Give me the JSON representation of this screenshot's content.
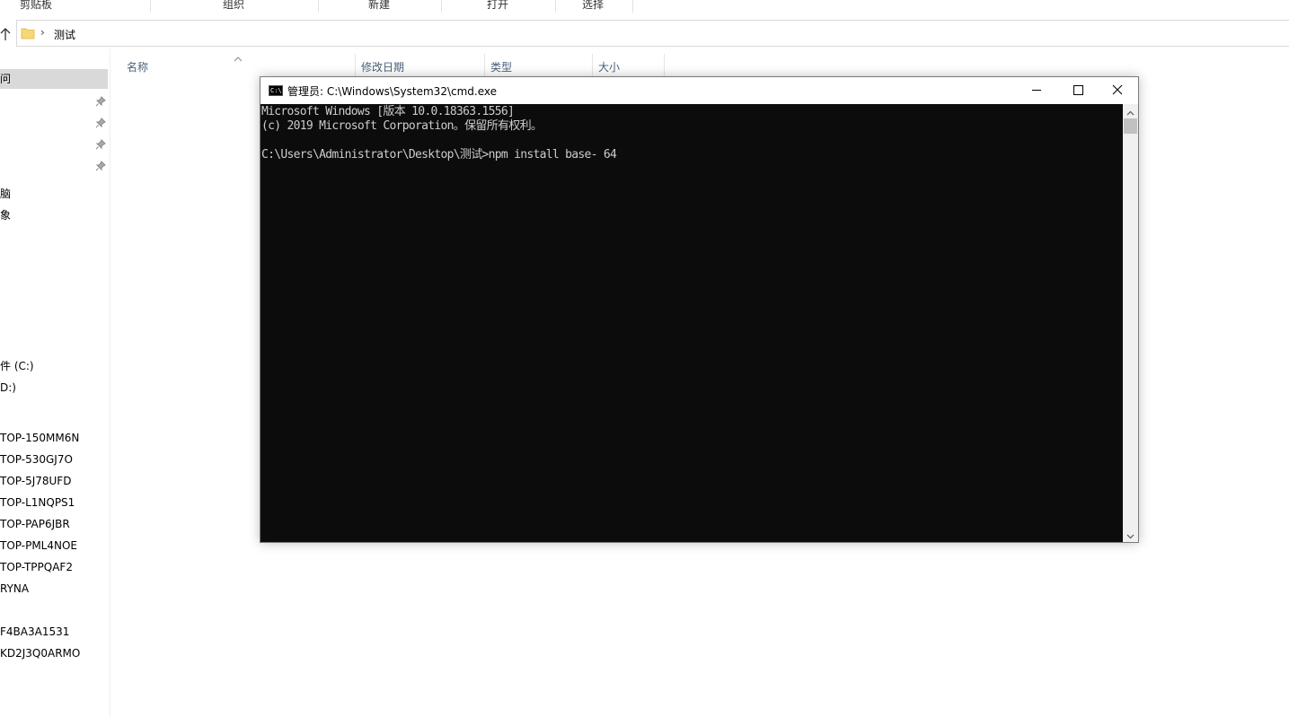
{
  "ribbon": {
    "groups": [
      "剪贴板",
      "组织",
      "新建",
      "打开",
      "选择"
    ]
  },
  "address": {
    "path": "测试"
  },
  "nav": {
    "items_top": [
      "问",
      "脑",
      "象"
    ],
    "drives": [
      "件 (C:)",
      "D:)"
    ],
    "network": [
      "TOP-150MM6N",
      "TOP-530GJ7O",
      "TOP-5J78UFD",
      "TOP-L1NQPS1",
      "TOP-PAP6JBR",
      "TOP-PML4NOE",
      "TOP-TPPQAF2",
      "RYNA",
      "F4BA3A1531",
      "KD2J3Q0ARMO"
    ]
  },
  "columns": {
    "name": "名称",
    "modified": "修改日期",
    "type": "类型",
    "size": "大小"
  },
  "cmd": {
    "title": "管理员: C:\\Windows\\System32\\cmd.exe",
    "icon_text": "C:\\",
    "lines": [
      "Microsoft Windows [版本 10.0.18363.1556]",
      "(c) 2019 Microsoft Corporation。保留所有权利。",
      "",
      "C:\\Users\\Administrator\\Desktop\\测试>npm install base- 64"
    ]
  },
  "icons": {
    "up": "arrow-up-icon",
    "folder": "folder-icon",
    "pin": "pin-icon",
    "minimize": "minimize-icon",
    "maximize": "maximize-icon",
    "close": "close-icon",
    "sort": "sort-up-icon"
  }
}
